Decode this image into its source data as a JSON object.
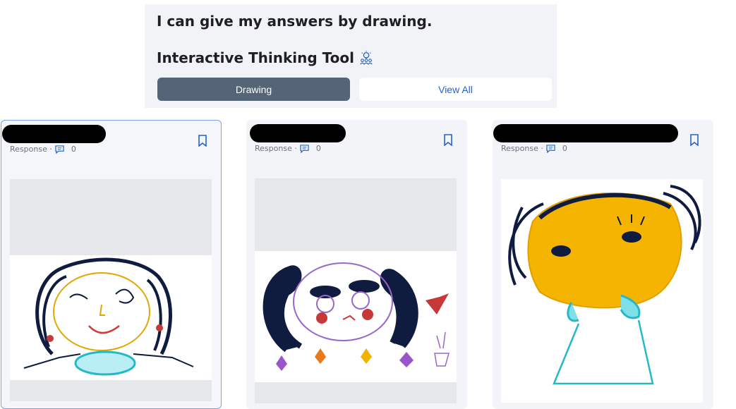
{
  "header": {
    "prompt": "I can give my answers by drawing.",
    "tool_title": "Interactive Thinking Tool",
    "tool_icon": "lightbulb-people-icon",
    "tabs": [
      {
        "label": "Drawing",
        "active": true
      },
      {
        "label": "View All",
        "active": false
      }
    ]
  },
  "cards": [
    {
      "meta_label": "Response ·",
      "comment_count": "0",
      "selected": true
    },
    {
      "meta_label": "Response ·",
      "comment_count": "0",
      "selected": false
    },
    {
      "meta_label": "Response ·",
      "comment_count": "0",
      "selected": false
    }
  ],
  "colors": {
    "active_tab": "#556476",
    "link_blue": "#2563c7",
    "panel_bg": "#f1f3f7"
  }
}
